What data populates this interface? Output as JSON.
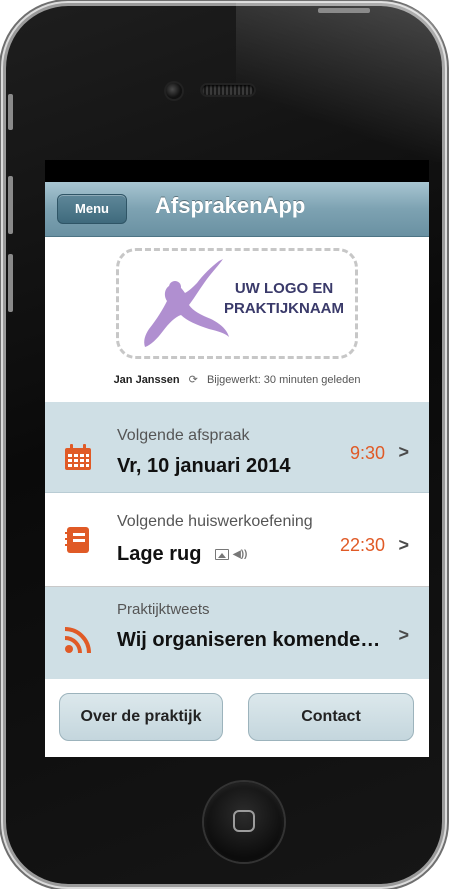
{
  "navbar": {
    "menu_label": "Menu",
    "title": "AfsprakenApp"
  },
  "header": {
    "logo_text_line1": "UW LOGO EN",
    "logo_text_line2": "PRAKTIJKNAAM",
    "user_name": "Jan Janssen",
    "updated_text": "Bijgewerkt: 30 minuten geleden"
  },
  "rows": [
    {
      "icon": "calendar-icon",
      "label": "Volgende afspraak",
      "value": "Vr, 10 januari 2014",
      "time": "9:30"
    },
    {
      "icon": "notebook-icon",
      "label": "Volgende huiswerkoefening",
      "value": "Lage rug",
      "time": "22:30",
      "media": [
        "image-icon",
        "sound-icon"
      ]
    },
    {
      "icon": "rss-icon",
      "label": "Praktijktweets",
      "value": "Wij organiseren komende…"
    }
  ],
  "buttons": {
    "about": "Over de praktijk",
    "contact": "Contact"
  },
  "colors": {
    "accent": "#e05a26",
    "navbar": "#7da2b2",
    "row_highlight": "#cfdfe5",
    "logo_figure": "#b08fd0"
  }
}
